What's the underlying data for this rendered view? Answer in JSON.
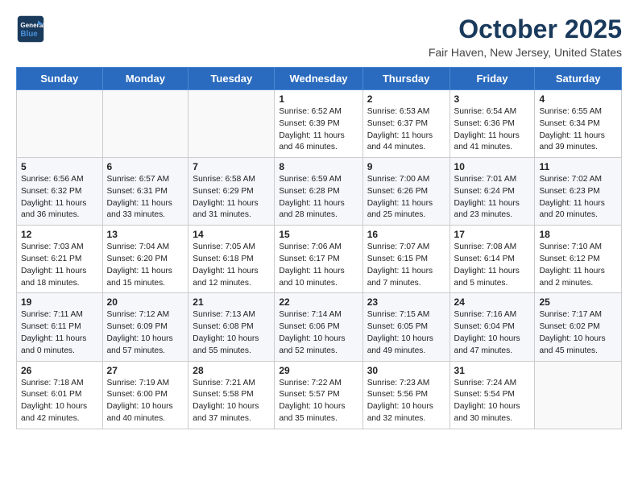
{
  "header": {
    "logo_line1": "General",
    "logo_line2": "Blue",
    "month_title": "October 2025",
    "location": "Fair Haven, New Jersey, United States"
  },
  "days_of_week": [
    "Sunday",
    "Monday",
    "Tuesday",
    "Wednesday",
    "Thursday",
    "Friday",
    "Saturday"
  ],
  "weeks": [
    [
      {
        "day": "",
        "info": ""
      },
      {
        "day": "",
        "info": ""
      },
      {
        "day": "",
        "info": ""
      },
      {
        "day": "1",
        "info": "Sunrise: 6:52 AM\nSunset: 6:39 PM\nDaylight: 11 hours\nand 46 minutes."
      },
      {
        "day": "2",
        "info": "Sunrise: 6:53 AM\nSunset: 6:37 PM\nDaylight: 11 hours\nand 44 minutes."
      },
      {
        "day": "3",
        "info": "Sunrise: 6:54 AM\nSunset: 6:36 PM\nDaylight: 11 hours\nand 41 minutes."
      },
      {
        "day": "4",
        "info": "Sunrise: 6:55 AM\nSunset: 6:34 PM\nDaylight: 11 hours\nand 39 minutes."
      }
    ],
    [
      {
        "day": "5",
        "info": "Sunrise: 6:56 AM\nSunset: 6:32 PM\nDaylight: 11 hours\nand 36 minutes."
      },
      {
        "day": "6",
        "info": "Sunrise: 6:57 AM\nSunset: 6:31 PM\nDaylight: 11 hours\nand 33 minutes."
      },
      {
        "day": "7",
        "info": "Sunrise: 6:58 AM\nSunset: 6:29 PM\nDaylight: 11 hours\nand 31 minutes."
      },
      {
        "day": "8",
        "info": "Sunrise: 6:59 AM\nSunset: 6:28 PM\nDaylight: 11 hours\nand 28 minutes."
      },
      {
        "day": "9",
        "info": "Sunrise: 7:00 AM\nSunset: 6:26 PM\nDaylight: 11 hours\nand 25 minutes."
      },
      {
        "day": "10",
        "info": "Sunrise: 7:01 AM\nSunset: 6:24 PM\nDaylight: 11 hours\nand 23 minutes."
      },
      {
        "day": "11",
        "info": "Sunrise: 7:02 AM\nSunset: 6:23 PM\nDaylight: 11 hours\nand 20 minutes."
      }
    ],
    [
      {
        "day": "12",
        "info": "Sunrise: 7:03 AM\nSunset: 6:21 PM\nDaylight: 11 hours\nand 18 minutes."
      },
      {
        "day": "13",
        "info": "Sunrise: 7:04 AM\nSunset: 6:20 PM\nDaylight: 11 hours\nand 15 minutes."
      },
      {
        "day": "14",
        "info": "Sunrise: 7:05 AM\nSunset: 6:18 PM\nDaylight: 11 hours\nand 12 minutes."
      },
      {
        "day": "15",
        "info": "Sunrise: 7:06 AM\nSunset: 6:17 PM\nDaylight: 11 hours\nand 10 minutes."
      },
      {
        "day": "16",
        "info": "Sunrise: 7:07 AM\nSunset: 6:15 PM\nDaylight: 11 hours\nand 7 minutes."
      },
      {
        "day": "17",
        "info": "Sunrise: 7:08 AM\nSunset: 6:14 PM\nDaylight: 11 hours\nand 5 minutes."
      },
      {
        "day": "18",
        "info": "Sunrise: 7:10 AM\nSunset: 6:12 PM\nDaylight: 11 hours\nand 2 minutes."
      }
    ],
    [
      {
        "day": "19",
        "info": "Sunrise: 7:11 AM\nSunset: 6:11 PM\nDaylight: 11 hours\nand 0 minutes."
      },
      {
        "day": "20",
        "info": "Sunrise: 7:12 AM\nSunset: 6:09 PM\nDaylight: 10 hours\nand 57 minutes."
      },
      {
        "day": "21",
        "info": "Sunrise: 7:13 AM\nSunset: 6:08 PM\nDaylight: 10 hours\nand 55 minutes."
      },
      {
        "day": "22",
        "info": "Sunrise: 7:14 AM\nSunset: 6:06 PM\nDaylight: 10 hours\nand 52 minutes."
      },
      {
        "day": "23",
        "info": "Sunrise: 7:15 AM\nSunset: 6:05 PM\nDaylight: 10 hours\nand 49 minutes."
      },
      {
        "day": "24",
        "info": "Sunrise: 7:16 AM\nSunset: 6:04 PM\nDaylight: 10 hours\nand 47 minutes."
      },
      {
        "day": "25",
        "info": "Sunrise: 7:17 AM\nSunset: 6:02 PM\nDaylight: 10 hours\nand 45 minutes."
      }
    ],
    [
      {
        "day": "26",
        "info": "Sunrise: 7:18 AM\nSunset: 6:01 PM\nDaylight: 10 hours\nand 42 minutes."
      },
      {
        "day": "27",
        "info": "Sunrise: 7:19 AM\nSunset: 6:00 PM\nDaylight: 10 hours\nand 40 minutes."
      },
      {
        "day": "28",
        "info": "Sunrise: 7:21 AM\nSunset: 5:58 PM\nDaylight: 10 hours\nand 37 minutes."
      },
      {
        "day": "29",
        "info": "Sunrise: 7:22 AM\nSunset: 5:57 PM\nDaylight: 10 hours\nand 35 minutes."
      },
      {
        "day": "30",
        "info": "Sunrise: 7:23 AM\nSunset: 5:56 PM\nDaylight: 10 hours\nand 32 minutes."
      },
      {
        "day": "31",
        "info": "Sunrise: 7:24 AM\nSunset: 5:54 PM\nDaylight: 10 hours\nand 30 minutes."
      },
      {
        "day": "",
        "info": ""
      }
    ]
  ]
}
